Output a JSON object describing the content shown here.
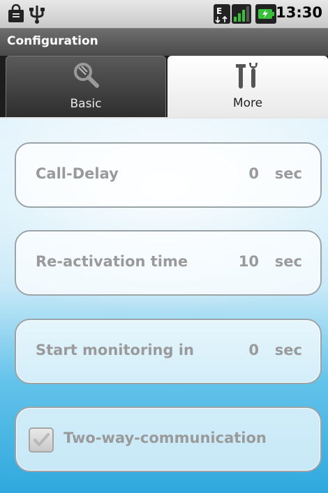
{
  "status_bar": {
    "time": "13:30",
    "icons": [
      "shopping-bag-icon",
      "usb-icon",
      "data-transfer-icon",
      "signal-icon",
      "battery-charging-icon"
    ]
  },
  "app": {
    "title": "Configuration"
  },
  "tabs": [
    {
      "label": "Basic",
      "icon": "wrench-magnifier-icon",
      "selected": false
    },
    {
      "label": "More",
      "icon": "tools-icon",
      "selected": true
    }
  ],
  "settings": [
    {
      "label": "Call-Delay",
      "value": "0",
      "unit": "sec"
    },
    {
      "label": "Re-activation time",
      "value": "10",
      "unit": "sec"
    },
    {
      "label": "Start monitoring in",
      "value": "0",
      "unit": "sec"
    }
  ],
  "two_way": {
    "label": "Two-way-communication",
    "checked": true
  },
  "colors": {
    "accent_blue": "#2fa8dd",
    "battery_green": "#39c03a",
    "text_disabled": "#9a9a9a"
  }
}
